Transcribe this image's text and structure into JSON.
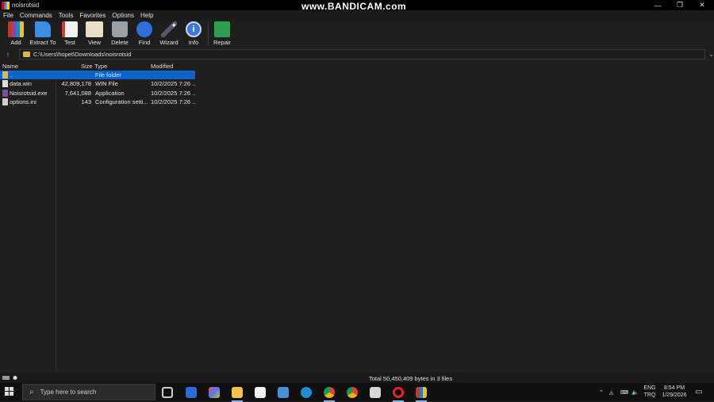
{
  "window": {
    "title": "noisrotsid",
    "watermark": "www.BANDICAM.com"
  },
  "window_controls": {
    "minimize": "—",
    "maximize": "❐",
    "close": "✕"
  },
  "menu": [
    "File",
    "Commands",
    "Tools",
    "Favorites",
    "Options",
    "Help"
  ],
  "toolbar": [
    {
      "label": "Add",
      "icon": "add-archive-icon",
      "color": "#8e44ad"
    },
    {
      "label": "Extract To",
      "icon": "extract-folder-icon",
      "color": "#3a8ee6"
    },
    {
      "label": "Test",
      "icon": "test-icon",
      "color": "#d23b3b"
    },
    {
      "label": "View",
      "icon": "view-book-icon",
      "color": "#e7dfc8"
    },
    {
      "label": "Delete",
      "icon": "trash-icon",
      "color": "#9aa0a6"
    },
    {
      "label": "Find",
      "icon": "magnifier-icon",
      "color": "#2f6fd8"
    },
    {
      "label": "Wizard",
      "icon": "wand-icon",
      "color": "#555b66"
    },
    {
      "label": "Info",
      "icon": "info-icon",
      "color": "#3b78d8"
    },
    {
      "label": "Repair",
      "icon": "first-aid-icon",
      "color": "#2e9e4f"
    }
  ],
  "address": {
    "path": "C:\\Users\\hopet\\Downloads\\noisrotsid"
  },
  "columns": {
    "name": "Name",
    "size": "Size",
    "type": "Type",
    "modified": "Modified"
  },
  "files": [
    {
      "name": "..",
      "size": "",
      "type": "File folder",
      "modified": ""
    },
    {
      "name": "data.win",
      "size": "42,809,178",
      "type": "WIN File",
      "modified": "10/2/2025 7:26 ..."
    },
    {
      "name": "Noisrotsid.exe",
      "size": "7,641,088",
      "type": "Application",
      "modified": "10/2/2025 7:26 ..."
    },
    {
      "name": "options.ini",
      "size": "143",
      "type": "Configuration setti...",
      "modified": "10/2/2025 7:26 ..."
    }
  ],
  "status": {
    "text": "Total 50,450,409 bytes in 3 files"
  },
  "taskbar": {
    "search_placeholder": "Type here to search",
    "apps": [
      "task-view-icon",
      "mail-icon",
      "copilot-icon",
      "file-explorer-icon",
      "store-icon",
      "remote-desktop-icon",
      "edge-icon",
      "chrome-icon",
      "chrome-icon",
      "printer-icon",
      "bandicam-record-icon",
      "winrar-icon"
    ],
    "lang_top": "ENG",
    "lang_bottom": "TRQ",
    "time": "8:54 PM",
    "date": "1/29/2026"
  },
  "colors": {
    "selection": "#0a64c8",
    "background": "#1e1e1e",
    "taskbar": "#101010"
  }
}
